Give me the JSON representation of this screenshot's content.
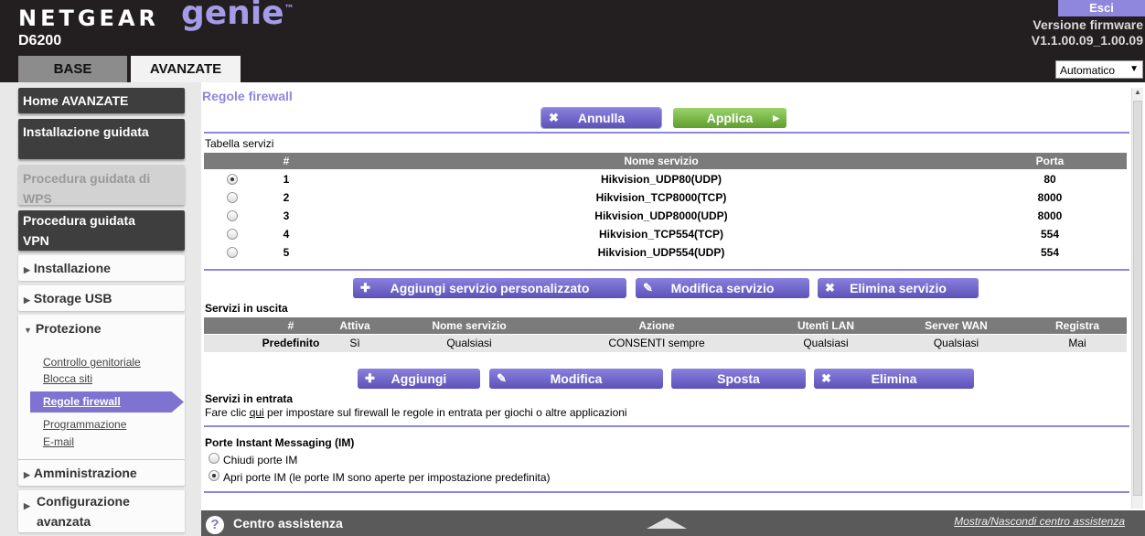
{
  "header": {
    "brand": "NETGEAR",
    "product": "genie",
    "model": "D6200",
    "logout_label": "Esci",
    "firmware_label": "Versione firmware",
    "firmware_version": "V1.1.00.09_1.00.09",
    "tabs": [
      {
        "label": "BASE",
        "active": false
      },
      {
        "label": "AVANZATE",
        "active": true
      }
    ],
    "language_selected": "Automatico"
  },
  "sidebar": {
    "home": "Home AVANZATE",
    "setup_wizard": "Installazione guidata",
    "wps_wizard_line1": "Procedura guidata di",
    "wps_wizard_line2": "WPS",
    "vpn_wizard_line1": "Procedura guidata",
    "vpn_wizard_line2": "VPN",
    "setup": "Installazione",
    "usb_storage": "Storage USB",
    "security": "Protezione",
    "security_items": [
      "Controllo genitoriale",
      "Blocca siti",
      "Regole firewall",
      "Programmazione",
      "E-mail"
    ],
    "administration": "Amministrazione",
    "advanced_setup_line1": "Configurazione",
    "advanced_setup_line2": "avanzata"
  },
  "main": {
    "title": "Regole firewall",
    "cancel_label": "Annulla",
    "apply_label": "Applica",
    "services_table": {
      "label": "Tabella servizi",
      "headers": [
        "#",
        "Nome servizio",
        "Porta"
      ],
      "rows": [
        {
          "num": "1",
          "name": "Hikvision_UDP80(UDP)",
          "port": "80",
          "selected": true
        },
        {
          "num": "2",
          "name": "Hikvision_TCP8000(TCP)",
          "port": "8000",
          "selected": false
        },
        {
          "num": "3",
          "name": "Hikvision_UDP8000(UDP)",
          "port": "8000",
          "selected": false
        },
        {
          "num": "4",
          "name": "Hikvision_TCP554(TCP)",
          "port": "554",
          "selected": false
        },
        {
          "num": "5",
          "name": "Hikvision_UDP554(UDP)",
          "port": "554",
          "selected": false
        }
      ]
    },
    "add_custom_service_label": "Aggiungi servizio personalizzato",
    "edit_service_label": "Modifica servizio",
    "delete_service_label": "Elimina servizio",
    "outbound": {
      "label": "Servizi in uscita",
      "headers": [
        "#",
        "Attiva",
        "Nome servizio",
        "Azione",
        "Utenti LAN",
        "Server WAN",
        "Registra"
      ],
      "row": [
        "Predefinito",
        "Sì",
        "Qualsiasi",
        "CONSENTI sempre",
        "Qualsiasi",
        "Qualsiasi",
        "Mai"
      ]
    },
    "add_label": "Aggiungi",
    "edit_label": "Modifica",
    "move_label": "Sposta",
    "delete_label": "Elimina",
    "inbound": {
      "label": "Servizi in entrata",
      "text_before": "Fare clic ",
      "link": "qui",
      "text_after": " per impostare sul firewall le regole in entrata per giochi o altre applicazioni"
    },
    "im_ports": {
      "label": "Porte Instant Messaging (IM)",
      "option_close": "Chiudi porte IM",
      "option_open": "Apri porte IM (le porte IM sono aperte per impostazione predefinita)",
      "selected": "open"
    }
  },
  "help": {
    "title": "Centro assistenza",
    "toggle_label": "Mostra/Nascondi centro assistenza"
  }
}
